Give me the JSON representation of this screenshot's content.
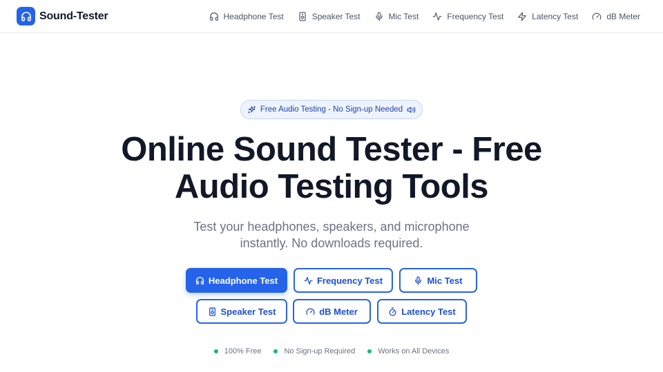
{
  "brand": {
    "name": "Sound-Tester",
    "icon": "headphones-icon"
  },
  "nav": [
    {
      "label": "Headphone Test",
      "icon": "headphones-icon"
    },
    {
      "label": "Speaker Test",
      "icon": "speaker-icon"
    },
    {
      "label": "Mic Test",
      "icon": "mic-icon"
    },
    {
      "label": "Frequency Test",
      "icon": "activity-icon"
    },
    {
      "label": "Latency Test",
      "icon": "zap-icon"
    },
    {
      "label": "dB Meter",
      "icon": "gauge-icon"
    }
  ],
  "hero": {
    "badge": "Free Audio Testing - No Sign-up Needed",
    "title_line1": "Online Sound Tester - Free",
    "title_line2": "Audio Testing Tools",
    "subtitle_line1": "Test your headphones, speakers, and microphone",
    "subtitle_line2": "instantly. No downloads required."
  },
  "buttons": [
    {
      "label": "Headphone Test",
      "icon": "headphones-icon",
      "primary": true
    },
    {
      "label": "Frequency Test",
      "icon": "activity-icon"
    },
    {
      "label": "Mic Test",
      "icon": "mic-icon"
    },
    {
      "label": "Speaker Test",
      "icon": "speaker-icon"
    },
    {
      "label": "dB Meter",
      "icon": "gauge-icon"
    },
    {
      "label": "Latency Test",
      "icon": "timer-icon"
    }
  ],
  "features": [
    "100% Free",
    "No Sign-up Required",
    "Works on All Devices"
  ],
  "colors": {
    "accent": "#2563eb",
    "feature_dot": "#10b981",
    "text": "#111827",
    "muted": "#6b7280"
  }
}
